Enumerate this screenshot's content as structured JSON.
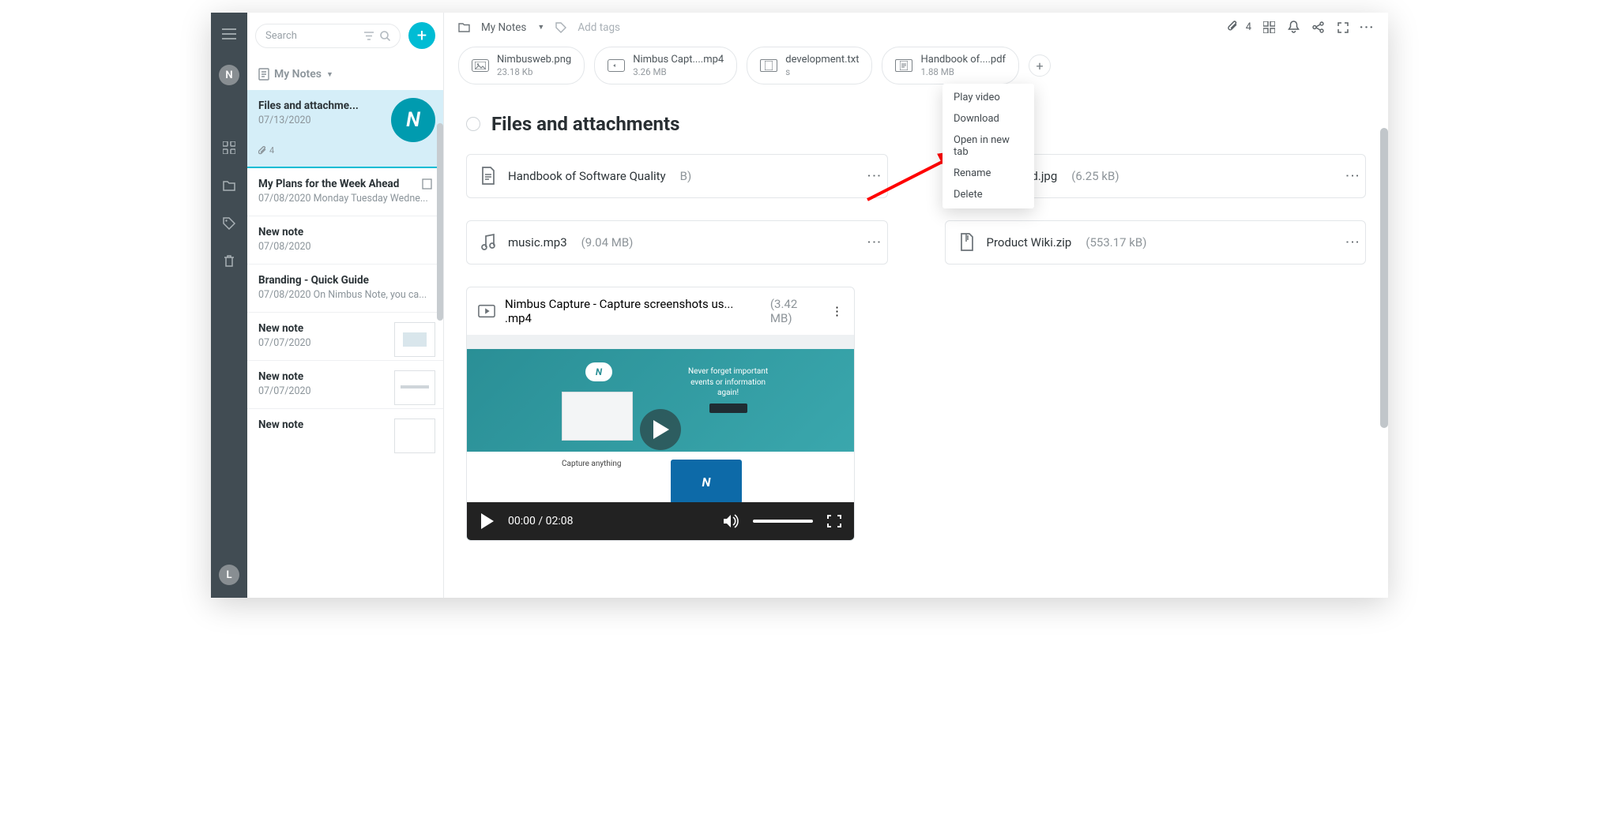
{
  "rail": {
    "avatar_top": "N",
    "avatar_bottom": "L"
  },
  "sidebar": {
    "search_placeholder": "Search",
    "folder_label": "My Notes",
    "notes": [
      {
        "title": "Files and attachme...",
        "date": "07/13/2020",
        "attach_count": "4"
      },
      {
        "title": "My Plans for the Week Ahead",
        "date": "07/08/2020",
        "preview": "Monday Tuesday Wedne..."
      },
      {
        "title": "New note",
        "date": "07/08/2020"
      },
      {
        "title": "Branding - Quick Guide",
        "date": "07/08/2020",
        "preview": "On Nimbus Note, you ca..."
      },
      {
        "title": "New note",
        "date": "07/07/2020"
      },
      {
        "title": "New note",
        "date": "07/07/2020"
      },
      {
        "title": "New note",
        "date": ""
      }
    ]
  },
  "topbar": {
    "breadcrumb": "My Notes",
    "add_tags": "Add tags",
    "attach_count": "4"
  },
  "pills": [
    {
      "name": "Nimbusweb.png",
      "size": "23.18 Kb",
      "type": "img"
    },
    {
      "name": "Nimbus Capt....mp4",
      "size": "3.26 MB",
      "type": "vid"
    },
    {
      "name": "development.txt",
      "size": "s",
      "type": "doc"
    },
    {
      "name": "Handbook of....pdf",
      "size": "1.88 MB",
      "type": "doc"
    }
  ],
  "page_title": "Files and attachments",
  "cards": [
    {
      "name": "Handbook of Software Quality",
      "size": "B)",
      "icon": "doc"
    },
    {
      "name": "download.jpg",
      "size": "(6.25 kB)",
      "icon": "img"
    },
    {
      "name": "music.mp3",
      "size": "(9.04 MB)",
      "icon": "aud"
    },
    {
      "name": "Product Wiki.zip",
      "size": "(553.17 kB)",
      "icon": "zip"
    }
  ],
  "video": {
    "name": "Nimbus Capture - Capture screenshots us... .mp4",
    "size": "(3.42 MB)",
    "time": "00:00 / 02:08",
    "promo_line1": "Never forget important",
    "promo_line2": "events or information",
    "promo_line3": "again!",
    "promo_sub": "Capture anything"
  },
  "context_menu": [
    "Play video",
    "Download",
    "Open in new tab",
    "Rename",
    "Delete"
  ]
}
